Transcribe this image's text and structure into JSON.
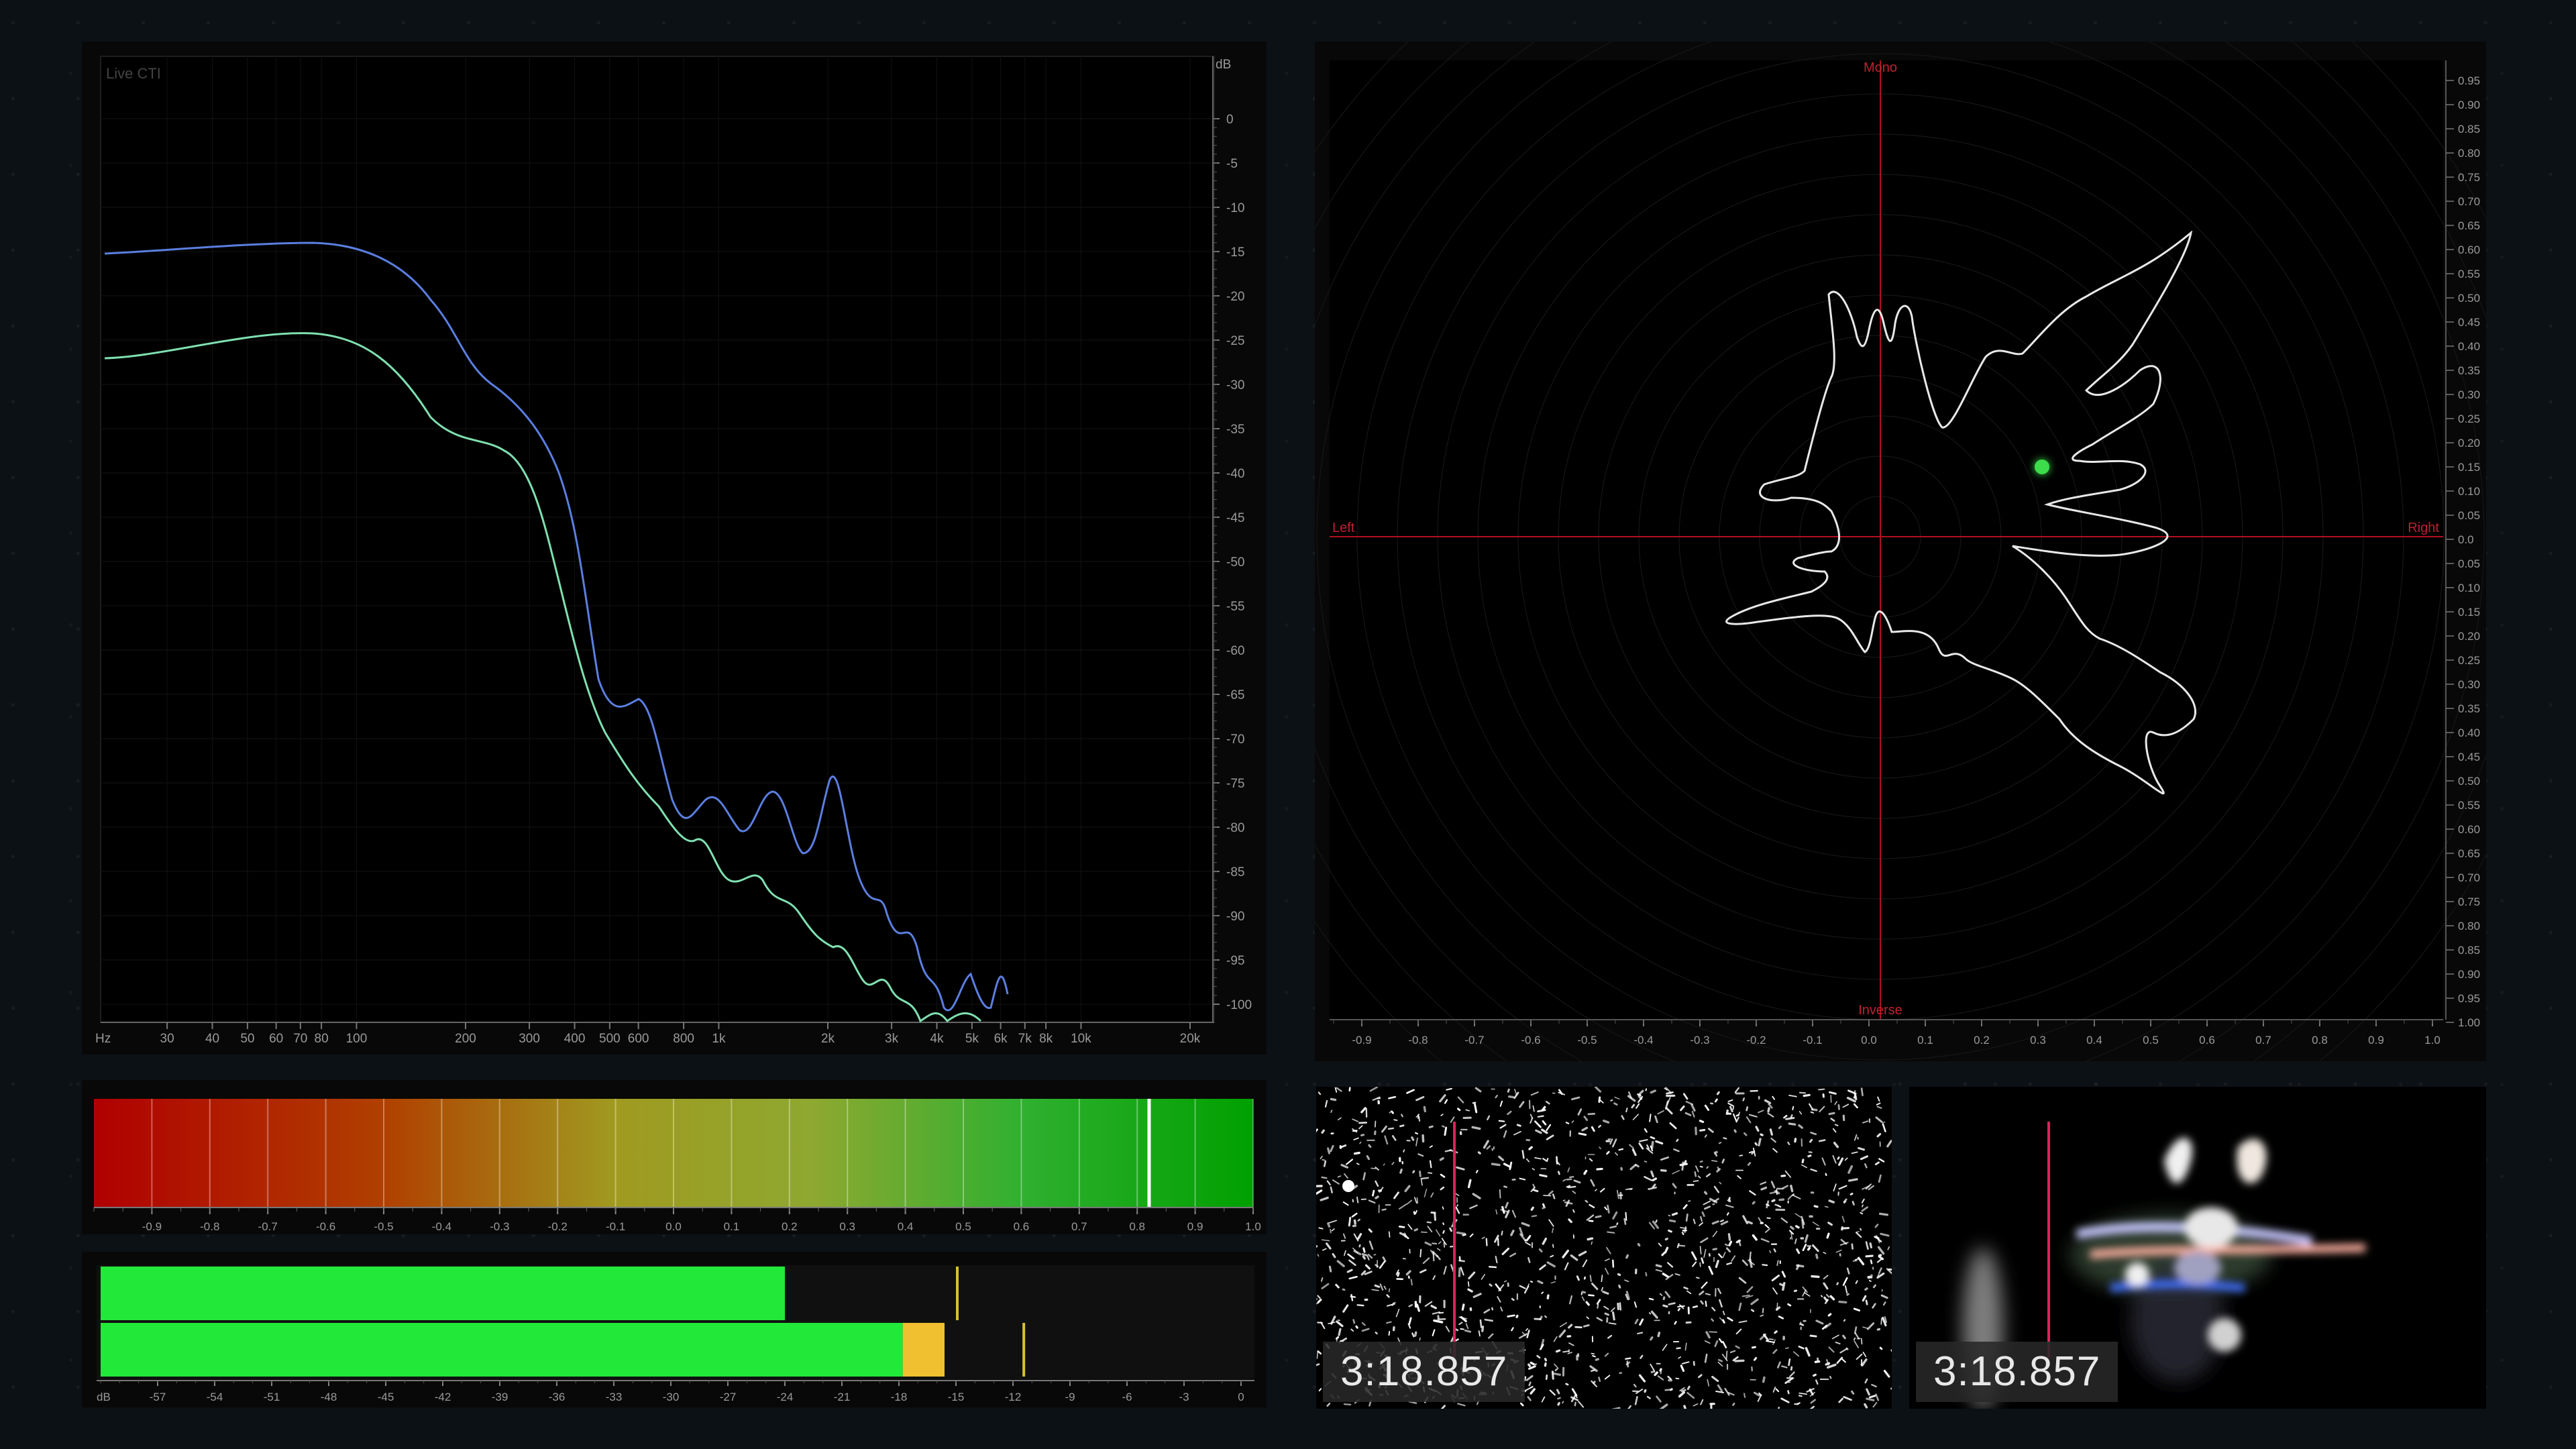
{
  "spectrum": {
    "title": "Live CTI",
    "y_unit": "dB",
    "y_ticks": [
      "0",
      "-5",
      "-10",
      "-15",
      "-20",
      "-25",
      "-30",
      "-35",
      "-40",
      "-45",
      "-50",
      "-55",
      "-60",
      "-65",
      "-70",
      "-75",
      "-80",
      "-85",
      "-90",
      "-95",
      "-100"
    ],
    "x_unit": "Hz",
    "x_ticks": [
      "30",
      "40",
      "50",
      "60",
      "70",
      "80",
      "100",
      "200",
      "300",
      "400",
      "500",
      "600",
      "800",
      "1k",
      "2k",
      "3k",
      "4k",
      "5k",
      "6k",
      "7k",
      "8k",
      "10k",
      "20k"
    ],
    "series_colors": {
      "upper": "#5b7fe0",
      "lower": "#7fe0b0"
    }
  },
  "vectorscope": {
    "label_top": "Mono",
    "label_bottom": "Inverse",
    "label_left": "Left",
    "label_right": "Right",
    "x_ticks": [
      "-0.9",
      "-0.8",
      "-0.7",
      "-0.6",
      "-0.5",
      "-0.4",
      "-0.3",
      "-0.2",
      "-0.1",
      "0.0",
      "0.1",
      "0.2",
      "0.3",
      "0.4",
      "0.5",
      "0.6",
      "0.7",
      "0.8",
      "0.9",
      "1.0"
    ],
    "y_ticks": [
      "0.95",
      "0.90",
      "0.85",
      "0.80",
      "0.75",
      "0.70",
      "0.65",
      "0.60",
      "0.55",
      "0.50",
      "0.45",
      "0.40",
      "0.35",
      "0.30",
      "0.25",
      "0.20",
      "0.15",
      "0.10",
      "0.05",
      "0.0",
      "0.05",
      "0.10",
      "0.15",
      "0.20",
      "0.25",
      "0.30",
      "0.35",
      "0.40",
      "0.45",
      "0.50",
      "0.55",
      "0.60",
      "0.65",
      "0.70",
      "0.75",
      "0.80",
      "0.85",
      "0.90",
      "0.95",
      "1.00"
    ],
    "colors": {
      "axis": "#b01020",
      "trace": "#e8e8e8",
      "dot": "#3ddc4a"
    }
  },
  "correlation": {
    "ticks": [
      "-0.9",
      "-0.8",
      "-0.7",
      "-0.6",
      "-0.5",
      "-0.4",
      "-0.3",
      "-0.2",
      "-0.1",
      "0.0",
      "0.1",
      "0.2",
      "0.3",
      "0.4",
      "0.5",
      "0.6",
      "0.7",
      "0.8",
      "0.9",
      "1.0"
    ],
    "marker_value": 0.82
  },
  "level_meter": {
    "unit": "dB",
    "ticks": [
      "-57",
      "-54",
      "-51",
      "-48",
      "-45",
      "-42",
      "-39",
      "-36",
      "-33",
      "-30",
      "-27",
      "-24",
      "-21",
      "-18",
      "-15",
      "-12",
      "-9",
      "-6",
      "-3",
      "0"
    ],
    "channel_1_level_db": -24,
    "channel_2_level_db": -17.8,
    "channel_2_peak_db": -15.6,
    "channel_1_hold_db": -15,
    "channel_2_hold_db": -11.5,
    "colors": {
      "bar": "#22e83a",
      "peak": "#f0c030",
      "hold": "#d8c030"
    }
  },
  "video_left": {
    "timecode": "3:18.857"
  },
  "video_right": {
    "timecode": "3:18.857"
  }
}
